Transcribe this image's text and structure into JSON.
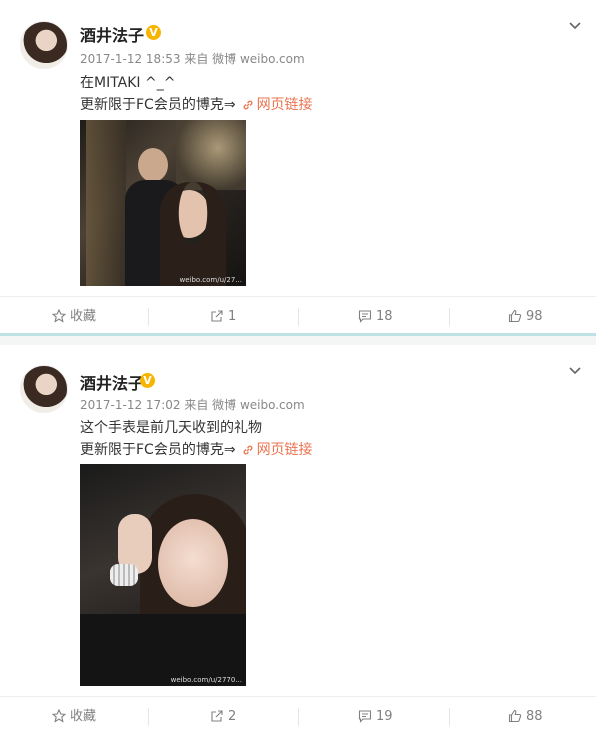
{
  "posts": [
    {
      "username": "酒井法子",
      "verified_badge": "V",
      "meta": "2017-1-12 18:53 来自 微博 weibo.com",
      "text": "在MITAKI ^_^",
      "line2_prefix": "更新限于FC会员的博克⇒",
      "link_label": "网页链接",
      "watermark": "weibo.com/u/27...",
      "actions": {
        "favorite": "收藏",
        "repost": "1",
        "comment": "18",
        "like": "98"
      }
    },
    {
      "username": "酒井法子",
      "verified_badge": "V",
      "meta": "2017-1-12 17:02 来自 微博 weibo.com",
      "text": "这个手表是前几天收到的礼物",
      "line2_prefix": "更新限于FC会员的博克⇒",
      "link_label": "网页链接",
      "watermark": "weibo.com/u/2770...",
      "actions": {
        "favorite": "收藏",
        "repost": "2",
        "comment": "19",
        "like": "88"
      }
    }
  ],
  "colors": {
    "link": "#eb7350",
    "badge": "#f7b500",
    "separator": "#bfe2e6"
  },
  "icons": [
    "chevron-down-icon",
    "link-icon",
    "star-icon",
    "repost-icon",
    "comment-icon",
    "thumbs-up-icon"
  ]
}
